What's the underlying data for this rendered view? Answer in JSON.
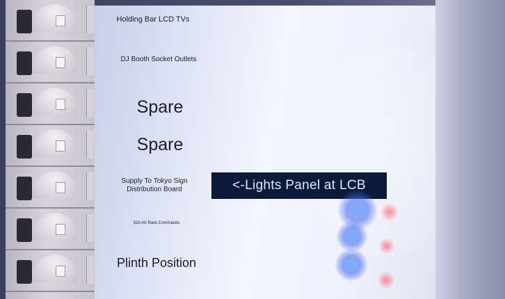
{
  "scene": "electrical distribution board with breakers and labeled panel",
  "labels": {
    "holding_bar": "Holding Bar LCD TVs",
    "dj_booth": "DJ Booth Socket Outlets",
    "spare_1": "Spare",
    "spare_2": "Spare",
    "tokyo_supply": "Supply To Tokyo Sign Distribution Board",
    "av_rack": "32A AV Rack Commands",
    "plinth": "Plinth Position"
  },
  "display": {
    "text": "<-Lights Panel at LCB"
  },
  "colors": {
    "board": "#f0f1fb",
    "display_bg": "#0b1a3a",
    "led_glow": "#6e8cf0"
  }
}
